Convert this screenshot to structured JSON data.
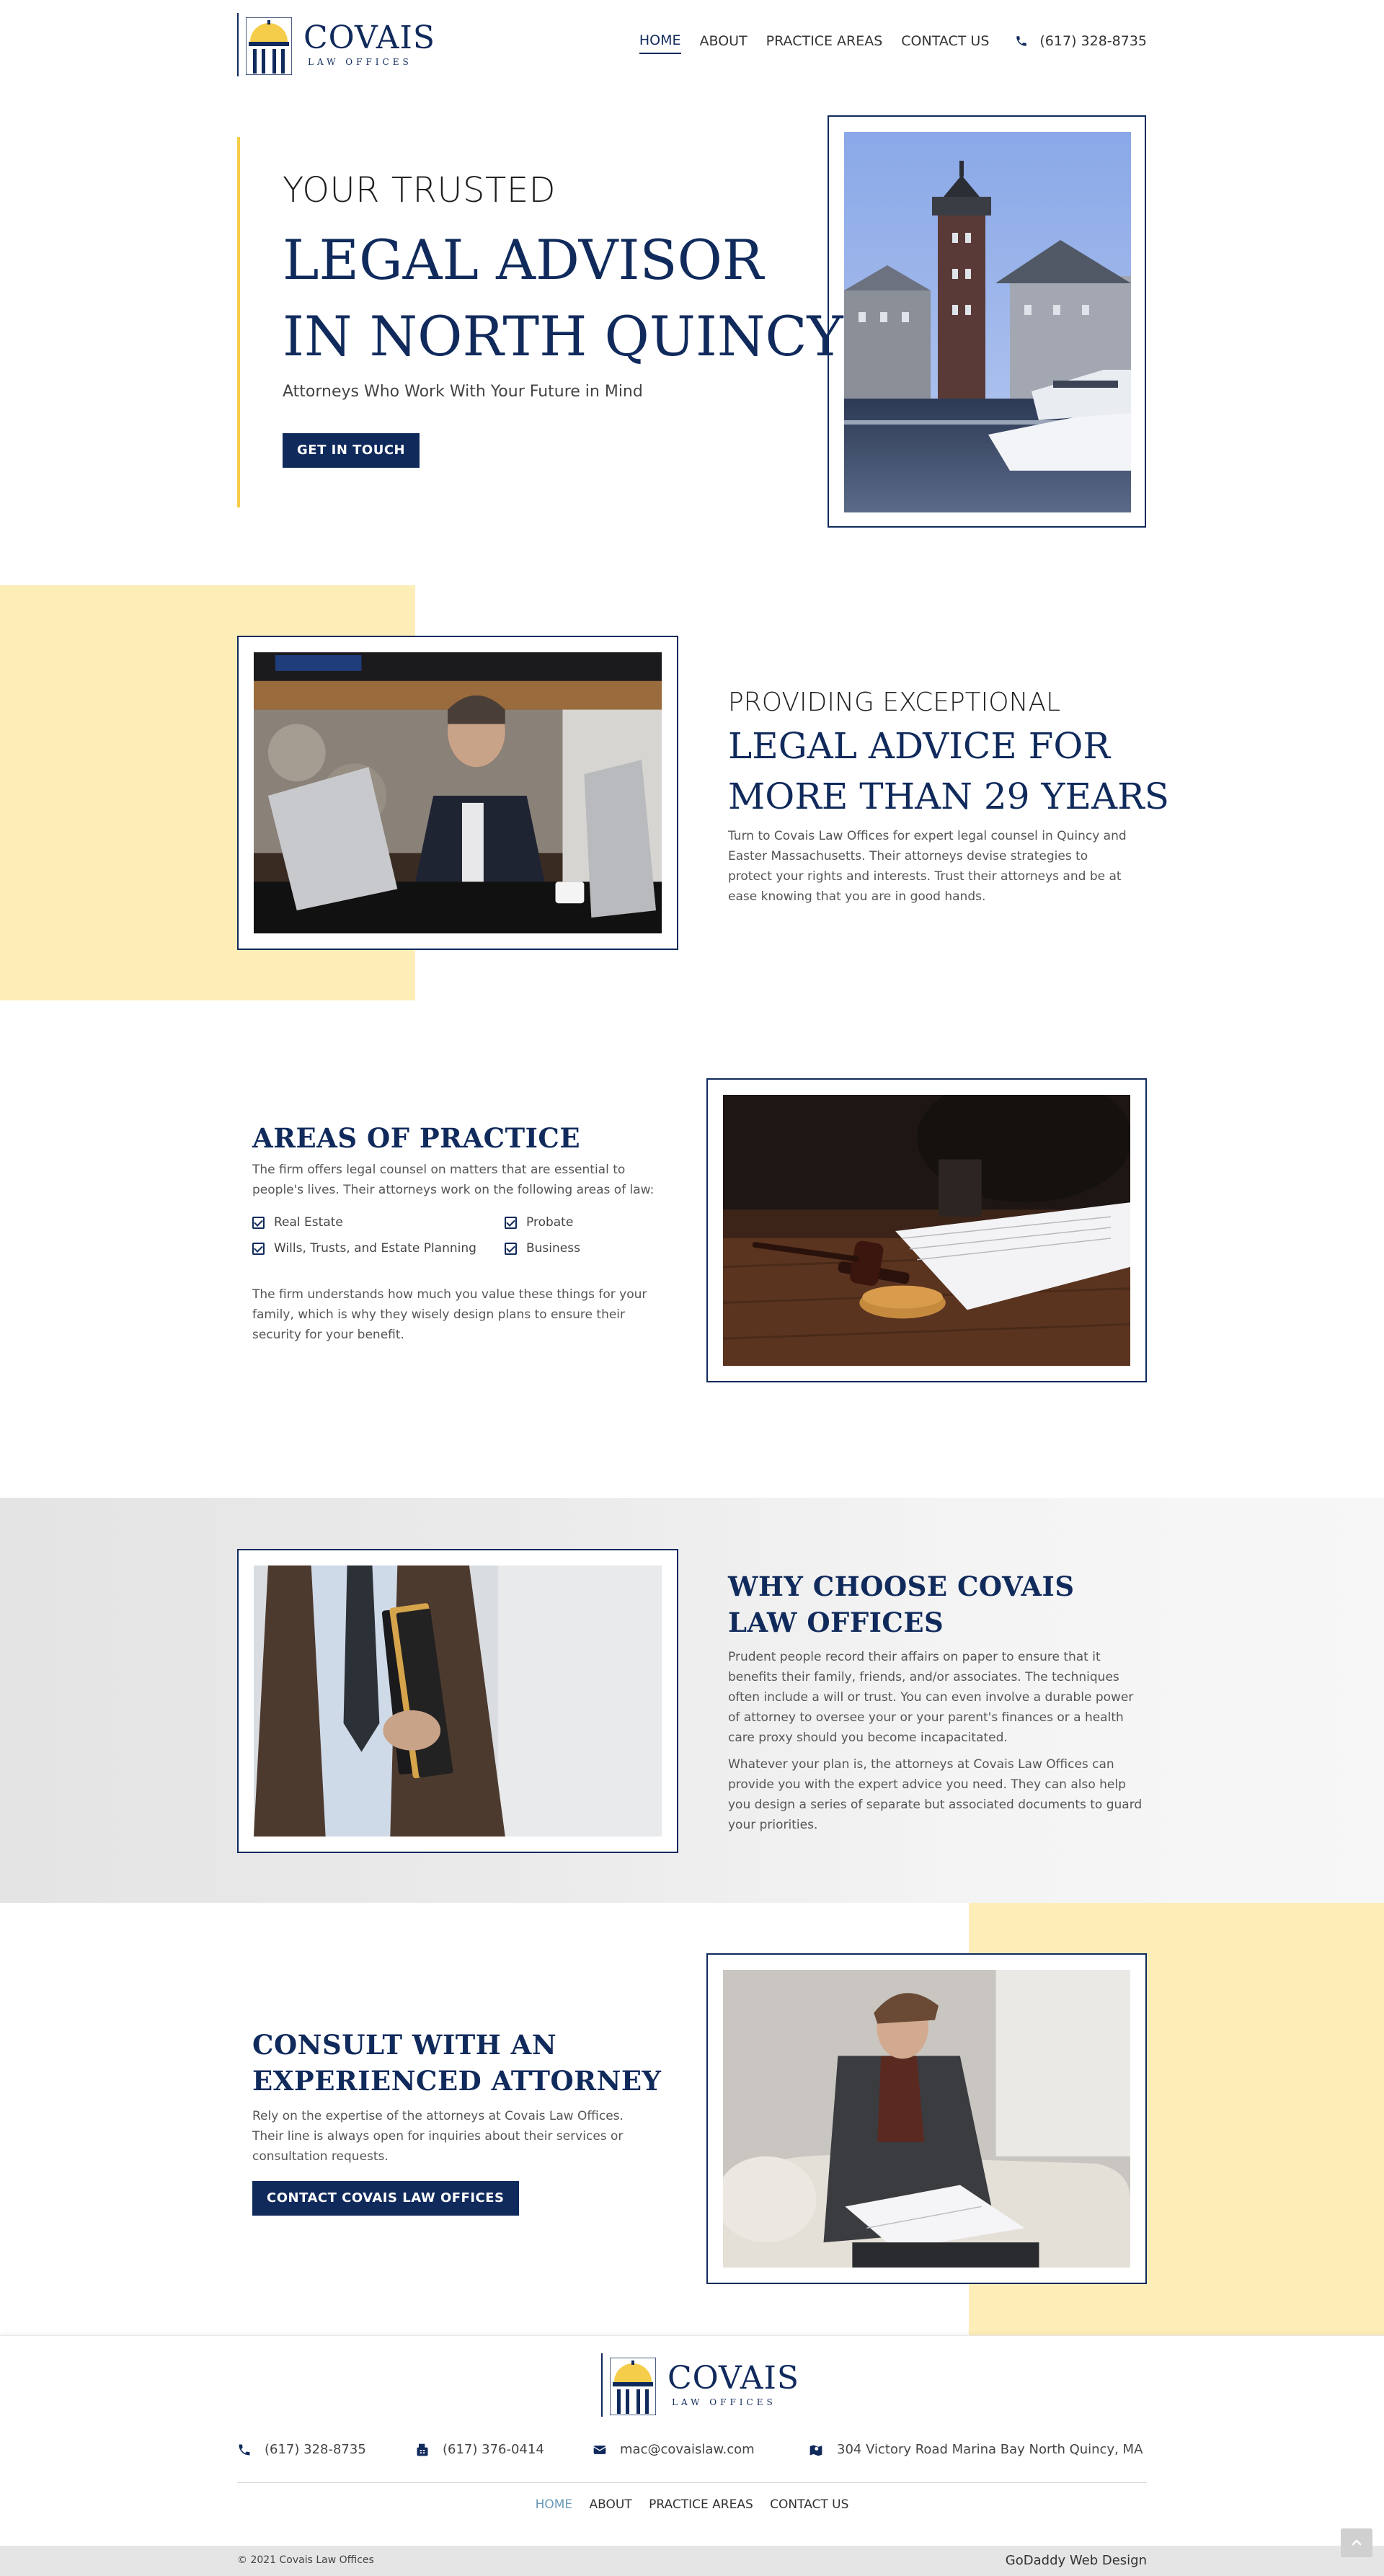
{
  "brand": {
    "name": "COVAIS",
    "tagline": "LAW OFFICES",
    "navy": "#102a5c",
    "gold": "#f6cd4a",
    "cream": "#fdeeb7"
  },
  "nav": {
    "items": [
      {
        "label": "HOME",
        "active": true
      },
      {
        "label": "ABOUT",
        "active": false
      },
      {
        "label": "PRACTICE AREAS",
        "active": false
      },
      {
        "label": "CONTACT US",
        "active": false
      }
    ],
    "phone": "(617) 328-8735",
    "phone_icon": "phone-icon"
  },
  "hero": {
    "kicker": "YOUR TRUSTED",
    "title_line1": "LEGAL ADVISOR",
    "title_line2": "IN NORTH QUINCY",
    "subtitle": "Attorneys Who Work With Your Future in Mind",
    "cta": "GET IN TOUCH",
    "image": "lighthouse-marina-photo"
  },
  "about": {
    "kicker": "PROVIDING EXCEPTIONAL",
    "title_line1": "LEGAL ADVICE FOR",
    "title_line2": "MORE THAN 29 YEARS",
    "body": "Turn to Covais Law Offices for expert legal counsel in Quincy and Easter Massachusetts. Their attorneys devise strategies to protect your rights and interests. Trust their attorneys and be at ease knowing that you are in good hands.",
    "image": "attorney-at-laptop-photo"
  },
  "practice": {
    "title": "AREAS OF PRACTICE",
    "intro": "The firm offers legal counsel on matters that are essential to people's lives. Their attorneys work on the following areas of law:",
    "areas": [
      "Real Estate",
      "Probate",
      "Wills, Trusts, and Estate Planning",
      "Business"
    ],
    "outro": "The firm understands how much you value these things for your family, which is why they wisely design plans to ensure their security for your benefit.",
    "image": "gavel-signing-photo"
  },
  "why": {
    "title_line1": "WHY CHOOSE COVAIS",
    "title_line2": "LAW OFFICES",
    "para1": "Prudent people record their affairs on paper to ensure that it benefits their family, friends, and/or associates. The techniques often include a will or trust. You can even involve a durable power of attorney to oversee your or your parent's finances or a health care proxy should you become incapacitated.",
    "para2": "Whatever your plan is, the attorneys at Covais Law Offices can provide you with the expert advice you need. They can also help you design a series of separate but associated documents to guard your priorities.",
    "image": "man-holding-books-photo"
  },
  "consult": {
    "title_line1": "CONSULT WITH AN",
    "title_line2": "EXPERIENCED ATTORNEY",
    "body": "Rely on the expertise of the attorneys at Covais Law Offices. Their line is always open for inquiries about their services or consultation requests.",
    "cta": "CONTACT COVAIS LAW OFFICES",
    "image": "man-reading-documents-photo"
  },
  "footer": {
    "phone": "(617) 328-8735",
    "fax": "(617) 376-0414",
    "email": "mac@covaislaw.com",
    "address": "304 Victory Road Marina Bay North Quincy, MA",
    "icons": [
      "phone-icon",
      "fax-icon",
      "envelope-icon",
      "map-icon"
    ],
    "nav": [
      "HOME",
      "ABOUT",
      "PRACTICE AREAS",
      "CONTACT US"
    ],
    "copyright": "© 2021 Covais Law Offices",
    "credit": "GoDaddy Web Design"
  }
}
